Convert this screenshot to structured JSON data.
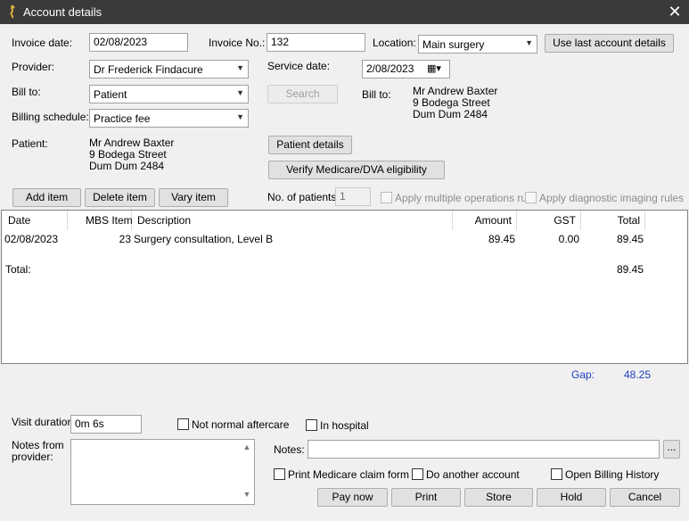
{
  "window": {
    "title": "Account details",
    "close_glyph": "✕"
  },
  "form": {
    "invoice_date_label": "Invoice date:",
    "invoice_date": "02/08/2023",
    "invoice_no_label": "Invoice No.:",
    "invoice_no": "132",
    "location_label": "Location:",
    "location": "Main surgery",
    "use_last_label": "Use last account details",
    "provider_label": "Provider:",
    "provider": "Dr Frederick Findacure",
    "service_date_label": "Service date:",
    "service_date": "2/08/2023",
    "bill_to_label": "Bill to:",
    "bill_to": "Patient",
    "search_label": "Search",
    "bill_to_addr_label": "Bill to:",
    "bill_to_addr": [
      "Mr Andrew Baxter",
      "9 Bodega Street",
      "Dum Dum 2484"
    ],
    "billing_schedule_label": "Billing schedule:",
    "billing_schedule": "Practice fee",
    "patient_label": "Patient:",
    "patient_addr": [
      "Mr Andrew Baxter",
      "9 Bodega Street",
      "Dum Dum  2484"
    ],
    "patient_details_label": "Patient details",
    "verify_label": "Verify Medicare/DVA eligibility",
    "add_item_label": "Add item",
    "delete_item_label": "Delete item",
    "vary_item_label": "Vary item",
    "num_patients_label": "No. of patients:",
    "num_patients": "1",
    "multi_ops_label": "Apply multiple operations rule",
    "diag_imaging_label": "Apply diagnostic imaging rules"
  },
  "grid": {
    "headers": [
      "Date",
      "MBS Item",
      "Description",
      "Amount",
      "GST",
      "Total"
    ],
    "rows": [
      {
        "date": "02/08/2023",
        "item": "23",
        "description": "Surgery consultation, Level B",
        "amount": "89.45",
        "gst": "0.00",
        "total": "89.45"
      }
    ],
    "total_label": "Total:",
    "total_value": "89.45"
  },
  "gap": {
    "label": "Gap:",
    "value": "48.25"
  },
  "bottom": {
    "visit_duration_label": "Visit duration:",
    "visit_duration": "0m  6s",
    "not_normal_label": "Not normal aftercare",
    "in_hospital_label": "In hospital",
    "notes_from_provider_label": "Notes from provider:",
    "notes_label": "Notes:",
    "notes_value": "",
    "ellipsis_label": "...",
    "print_medicare_label": "Print Medicare claim form",
    "do_another_label": "Do another account",
    "open_billing_label": "Open Billing History",
    "pay_now_label": "Pay now",
    "print_label": "Print",
    "store_label": "Store",
    "hold_label": "Hold",
    "cancel_label": "Cancel"
  },
  "colors": {
    "titlebar": "#3a3a3a",
    "gap_text": "#1f3fbf"
  }
}
